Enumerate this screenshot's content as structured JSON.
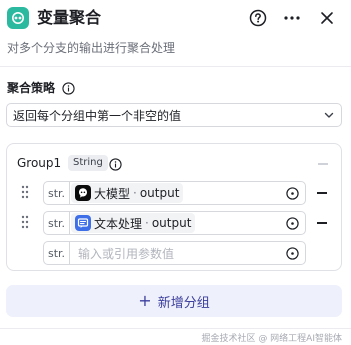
{
  "node": {
    "title": "变量聚合",
    "description": "对多个分支的输出进行聚合处理",
    "icon": "aggregate-icon",
    "accent_color": "#2bb99f"
  },
  "header_actions": {
    "help": "help-icon",
    "more": "more-icon",
    "close": "close-icon"
  },
  "strategy": {
    "label": "聚合策略",
    "selected": "返回每个分组中第一个非空的值"
  },
  "group": {
    "name": "Group1",
    "type": "String",
    "variables": [
      {
        "type_prefix": "str.",
        "source_icon": "llm-icon",
        "source": "大模型",
        "separator": "·",
        "field": "output"
      },
      {
        "type_prefix": "str.",
        "source_icon": "text-process-icon",
        "source": "文本处理",
        "separator": "·",
        "field": "output"
      }
    ],
    "empty_row": {
      "type_prefix": "str.",
      "placeholder": "输入或引用参数值"
    }
  },
  "add_group": {
    "label": "新增分组",
    "color": "#3c3f9e"
  },
  "watermark": "掘金技术社区 @ 网络工程AI智能体"
}
